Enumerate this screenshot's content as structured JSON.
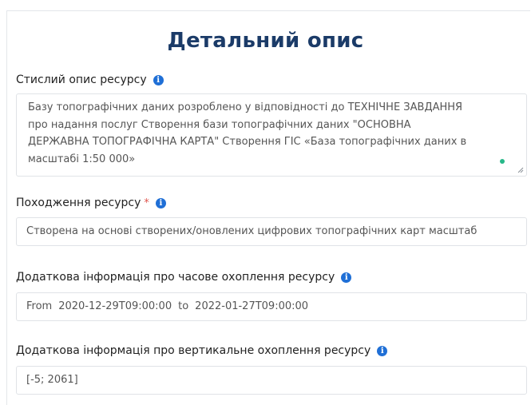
{
  "title": "Детальний опис",
  "short_description": {
    "label": "Стислий опис ресурсу",
    "value_lines": [
      "Базу топографічних даних розроблено у відповідності до ТЕХНІЧНЕ ЗАВДАННЯ",
      "про надання послуг Створення бази топографічних даних \"ОСНОВНА",
      "ДЕРЖАВНА ТОПОГРАФІЧНА КАРТА\" Створення ГІС «База топографічних даних в",
      "масштабі 1:50 000»"
    ]
  },
  "origin": {
    "label": "Походження ресурсу",
    "required_mark": "*",
    "value": "Створена на основі створених/оновлених цифрових топографічних карт масштаб"
  },
  "temporal": {
    "label": "Додаткова інформація про часове охоплення ресурсу",
    "from_label": "From",
    "from_value": "2020-12-29T09:00:00",
    "to_label": "to",
    "to_value": "2022-01-27T09:00:00"
  },
  "vertical": {
    "label": "Додаткова інформація про вертикальне охоплення ресурсу",
    "value": "[-5; 2061]"
  },
  "icons": {
    "info": "info-icon",
    "required": "required-asterisk",
    "resize": "resize-handle-icon"
  },
  "colors": {
    "title": "#1b3b68",
    "info": "#1f6fd6",
    "required": "#e0574f",
    "status_dot": "#27b889"
  }
}
